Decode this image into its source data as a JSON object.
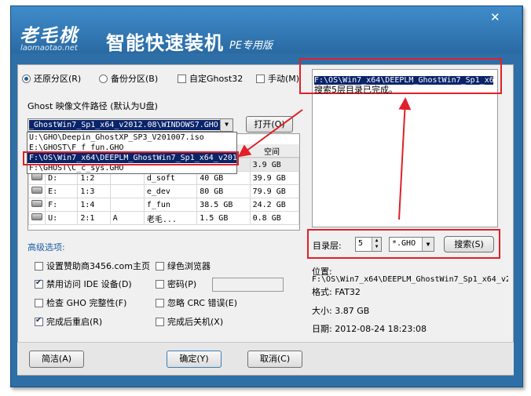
{
  "header": {
    "logo": "老毛桃",
    "logo_url": "laomaotao.net",
    "title": "智能快速装机",
    "edition": "PE专用版",
    "close_glyph": "✕"
  },
  "modes": {
    "restore": "还原分区(R)",
    "backup": "备份分区(B)",
    "custom": "自定Ghost32",
    "manual": "手动(M)"
  },
  "ghost_path": {
    "label": "Ghost 映像文件路径 (默认为U盘)",
    "current": "_GhostWin7_Sp1_x64_v2012.08\\WINDOWS7.GHO",
    "open_button": "打开(O)",
    "dropdown": [
      "U:\\GHO\\Deepin_GhostXP_SP3_V201007.iso",
      "E:\\GHOST\\F_f_fun.GHO",
      "F:\\OS\\Win7_x64\\DEEPLM_GhostWin7_Sp1_x64_v2012",
      "F:\\GHOST\\C_c_sys.GHO"
    ]
  },
  "partitions": {
    "header_tail": "空间",
    "rows": [
      {
        "drive": "",
        "part": "",
        "flag": "",
        "name": "",
        "total": "",
        "free": "3.9 GB"
      },
      {
        "drive": "D:",
        "part": "1:2",
        "flag": "",
        "name": "d_soft",
        "total": "40 GB",
        "free": "39.9 GB"
      },
      {
        "drive": "E:",
        "part": "1:3",
        "flag": "",
        "name": "e_dev",
        "total": "80 GB",
        "free": "79.9 GB"
      },
      {
        "drive": "F:",
        "part": "1:4",
        "flag": "",
        "name": "f_fun",
        "total": "38.5 GB",
        "free": "24.2 GB"
      },
      {
        "drive": "U:",
        "part": "2:1",
        "flag": "A",
        "name": "老毛...",
        "total": "1.5 GB",
        "free": "0.8 GB"
      }
    ]
  },
  "advanced": {
    "title": "高级选项:",
    "options": [
      {
        "label": "设置赞助商3456.com主页",
        "checked": false
      },
      {
        "label": "绿色浏览器",
        "checked": false
      },
      {
        "label": "禁用访问 IDE 设备(D)",
        "checked": true
      },
      {
        "label": "密码(P)",
        "checked": false
      },
      {
        "label": "检查 GHO 完整性(F)",
        "checked": false
      },
      {
        "label": "忽略 CRC 错误(E)",
        "checked": false
      },
      {
        "label": "完成后重启(R)",
        "checked": true
      },
      {
        "label": "完成后关机(X)",
        "checked": false
      }
    ],
    "password_value": ""
  },
  "search": {
    "result_path": "F:\\OS\\Win7_x64\\DEEPLM_GhostWin7_Sp1_x64_v2012",
    "result_message": "搜索5层目录已完成。",
    "depth_label": "目录层:",
    "depth_value": "5",
    "ext_value": "*.GHO",
    "search_button": "搜索(S)"
  },
  "info": {
    "location_label": "位置:",
    "location_value": "F:\\OS\\Win7_x64\\DEEPLM_GhostWin7_Sp1_x64_v2",
    "format": "格式: FAT32",
    "size": "大小: 3.87 GB",
    "date": "日期: 2012-08-24  18:23:08"
  },
  "footer": {
    "simple": "简洁(A)",
    "ok": "确定(Y)",
    "cancel": "取消(C)"
  },
  "colors": {
    "title_bg": "#2e6fa7",
    "highlight": "#0a246a",
    "annotation": "#e0202a"
  }
}
